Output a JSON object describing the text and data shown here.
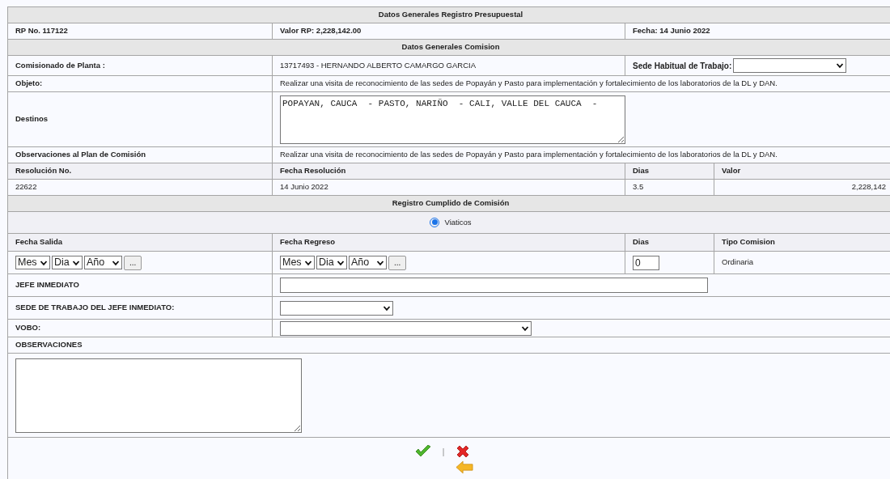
{
  "budget": {
    "title": "Datos Generales Registro Presupuestal",
    "rp_no": "RP No. 117122",
    "valor_rp": "Valor RP: 2,228,142.00",
    "fecha": "Fecha: 14 Junio 2022"
  },
  "commission": {
    "title": "Datos Generales Comision",
    "comisionado_label": "Comisionado de Planta :",
    "comisionado_value": "13717493 - HERNANDO ALBERTO CAMARGO GARCIA",
    "sede_label": "Sede Habitual de Trabajo:",
    "objeto_label": "Objeto:",
    "objeto_value": "Realizar una visita de reconocimiento de las sedes de Popayán y Pasto para implementación y fortalecimiento de los laboratorios de la DL y DAN.",
    "destinos_label": "Destinos",
    "destinos_value": "POPAYAN, CAUCA  - PASTO, NARIÑO  - CALI, VALLE DEL CAUCA  -",
    "observaciones_label": "Observaciones al Plan de Comisión",
    "observaciones_value": "Realizar una visita de reconocimiento de las sedes de Popayán y Pasto para implementación y fortalecimiento de los laboratorios de la DL y DAN."
  },
  "resolution": {
    "columns": [
      "Resolución No.",
      "Fecha Resolución",
      "Dias",
      "Valor"
    ],
    "values": [
      "22622",
      "14 Junio 2022",
      "3.5",
      "2,228,142"
    ]
  },
  "fulfilment": {
    "title": "Registro Cumplido de Comisión",
    "radio": {
      "label": "Viaticos",
      "selected": true
    },
    "columns": [
      "Fecha Salida",
      "Fecha Regreso",
      "Dias",
      "Tipo Comision"
    ],
    "dates": [
      {
        "month": "Mes",
        "day": "Dia",
        "year": "Año",
        "button": "..."
      },
      {
        "month": "Mes",
        "day": "Dia",
        "year": "Año",
        "button": "..."
      }
    ],
    "dias_value": "0",
    "tipo": "Ordinaria",
    "jefe_label": "JEFE INMEDIATO",
    "sede_jefe_label": "SEDE DE TRABAJO DEL JEFE INMEDIATO:",
    "vobo_label": "VOBO:",
    "observaciones_label": "OBSERVACIONES"
  },
  "actions": {
    "separator": "|"
  }
}
